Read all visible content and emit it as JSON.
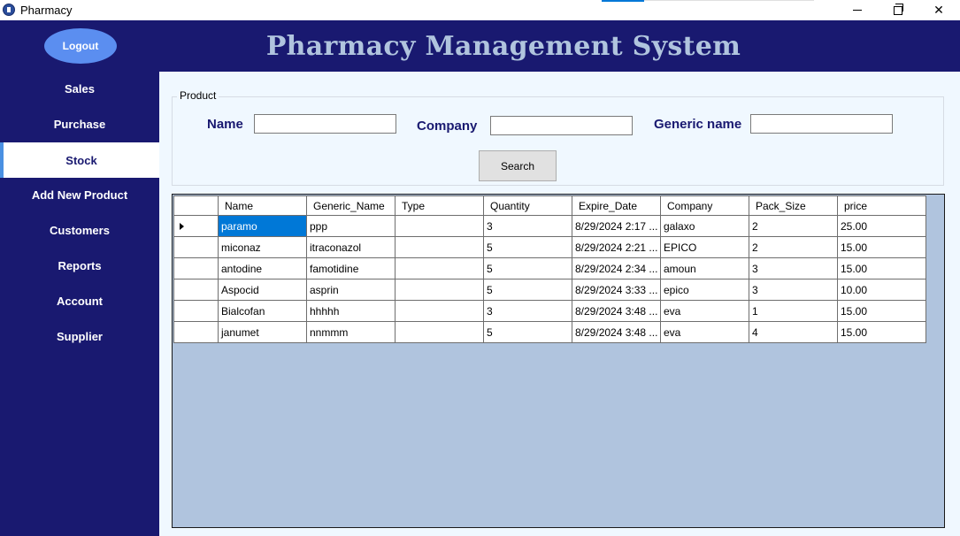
{
  "window": {
    "title": "Pharmacy"
  },
  "header": {
    "title": "Pharmacy Management System"
  },
  "sidebar": {
    "logout_label": "Logout",
    "items": [
      {
        "label": "Sales",
        "active": false
      },
      {
        "label": "Purchase",
        "active": false
      },
      {
        "label": "Stock",
        "active": true
      },
      {
        "label": "Add New Product",
        "active": false
      },
      {
        "label": "Customers",
        "active": false
      },
      {
        "label": "Reports",
        "active": false
      },
      {
        "label": "Account",
        "active": false
      },
      {
        "label": "Supplier",
        "active": false
      }
    ]
  },
  "search": {
    "group_title": "Product",
    "name_label": "Name",
    "name_value": "",
    "company_label": "Company",
    "company_value": "",
    "generic_label": "Generic name",
    "generic_value": "",
    "button_label": "Search"
  },
  "grid": {
    "columns": [
      "Name",
      "Generic_Name",
      "Type",
      "Quantity",
      "Expire_Date",
      "Company",
      "Pack_Size",
      "price"
    ],
    "rows": [
      [
        "paramo",
        "ppp",
        "",
        "3",
        "8/29/2024 2:17 ...",
        "galaxo",
        "2",
        "25.00"
      ],
      [
        "miconaz",
        "itraconazol",
        "",
        "5",
        "8/29/2024 2:21 ...",
        "EPICO",
        "2",
        "15.00"
      ],
      [
        "antodine",
        "famotidine",
        "",
        "5",
        "8/29/2024 2:34 ...",
        "amoun",
        "3",
        "15.00"
      ],
      [
        "Aspocid",
        "asprin",
        "",
        "5",
        "8/29/2024 3:33 ...",
        "epico",
        "3",
        "10.00"
      ],
      [
        "Bialcofan",
        "hhhhh",
        "",
        "3",
        "8/29/2024 3:48 ...",
        "eva",
        "1",
        "15.00"
      ],
      [
        "janumet",
        "nnmmm",
        "",
        "5",
        "8/29/2024 3:48 ...",
        "eva",
        "4",
        "15.00"
      ]
    ],
    "current_row": 0,
    "selected_cell": [
      0,
      0
    ]
  },
  "colors": {
    "sidebar": "#191970",
    "header_text": "#b0c4de",
    "logout_button": "#5b8ef0",
    "main_background": "#f0f8ff",
    "grid_background": "#b0c4de",
    "selection": "#0078d7"
  }
}
